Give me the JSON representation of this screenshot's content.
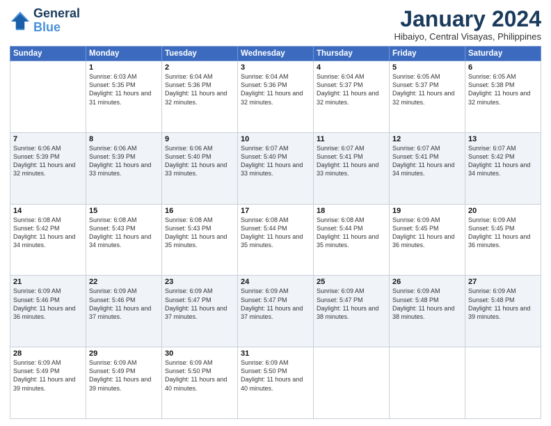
{
  "header": {
    "logo_line1": "General",
    "logo_line2": "Blue",
    "month_title": "January 2024",
    "location": "Hibaiyo, Central Visayas, Philippines"
  },
  "days_of_week": [
    "Sunday",
    "Monday",
    "Tuesday",
    "Wednesday",
    "Thursday",
    "Friday",
    "Saturday"
  ],
  "weeks": [
    [
      {
        "day": "",
        "sunrise": "",
        "sunset": "",
        "daylight": ""
      },
      {
        "day": "1",
        "sunrise": "Sunrise: 6:03 AM",
        "sunset": "Sunset: 5:35 PM",
        "daylight": "Daylight: 11 hours and 31 minutes."
      },
      {
        "day": "2",
        "sunrise": "Sunrise: 6:04 AM",
        "sunset": "Sunset: 5:36 PM",
        "daylight": "Daylight: 11 hours and 32 minutes."
      },
      {
        "day": "3",
        "sunrise": "Sunrise: 6:04 AM",
        "sunset": "Sunset: 5:36 PM",
        "daylight": "Daylight: 11 hours and 32 minutes."
      },
      {
        "day": "4",
        "sunrise": "Sunrise: 6:04 AM",
        "sunset": "Sunset: 5:37 PM",
        "daylight": "Daylight: 11 hours and 32 minutes."
      },
      {
        "day": "5",
        "sunrise": "Sunrise: 6:05 AM",
        "sunset": "Sunset: 5:37 PM",
        "daylight": "Daylight: 11 hours and 32 minutes."
      },
      {
        "day": "6",
        "sunrise": "Sunrise: 6:05 AM",
        "sunset": "Sunset: 5:38 PM",
        "daylight": "Daylight: 11 hours and 32 minutes."
      }
    ],
    [
      {
        "day": "7",
        "sunrise": "Sunrise: 6:06 AM",
        "sunset": "Sunset: 5:39 PM",
        "daylight": "Daylight: 11 hours and 32 minutes."
      },
      {
        "day": "8",
        "sunrise": "Sunrise: 6:06 AM",
        "sunset": "Sunset: 5:39 PM",
        "daylight": "Daylight: 11 hours and 33 minutes."
      },
      {
        "day": "9",
        "sunrise": "Sunrise: 6:06 AM",
        "sunset": "Sunset: 5:40 PM",
        "daylight": "Daylight: 11 hours and 33 minutes."
      },
      {
        "day": "10",
        "sunrise": "Sunrise: 6:07 AM",
        "sunset": "Sunset: 5:40 PM",
        "daylight": "Daylight: 11 hours and 33 minutes."
      },
      {
        "day": "11",
        "sunrise": "Sunrise: 6:07 AM",
        "sunset": "Sunset: 5:41 PM",
        "daylight": "Daylight: 11 hours and 33 minutes."
      },
      {
        "day": "12",
        "sunrise": "Sunrise: 6:07 AM",
        "sunset": "Sunset: 5:41 PM",
        "daylight": "Daylight: 11 hours and 34 minutes."
      },
      {
        "day": "13",
        "sunrise": "Sunrise: 6:07 AM",
        "sunset": "Sunset: 5:42 PM",
        "daylight": "Daylight: 11 hours and 34 minutes."
      }
    ],
    [
      {
        "day": "14",
        "sunrise": "Sunrise: 6:08 AM",
        "sunset": "Sunset: 5:42 PM",
        "daylight": "Daylight: 11 hours and 34 minutes."
      },
      {
        "day": "15",
        "sunrise": "Sunrise: 6:08 AM",
        "sunset": "Sunset: 5:43 PM",
        "daylight": "Daylight: 11 hours and 34 minutes."
      },
      {
        "day": "16",
        "sunrise": "Sunrise: 6:08 AM",
        "sunset": "Sunset: 5:43 PM",
        "daylight": "Daylight: 11 hours and 35 minutes."
      },
      {
        "day": "17",
        "sunrise": "Sunrise: 6:08 AM",
        "sunset": "Sunset: 5:44 PM",
        "daylight": "Daylight: 11 hours and 35 minutes."
      },
      {
        "day": "18",
        "sunrise": "Sunrise: 6:08 AM",
        "sunset": "Sunset: 5:44 PM",
        "daylight": "Daylight: 11 hours and 35 minutes."
      },
      {
        "day": "19",
        "sunrise": "Sunrise: 6:09 AM",
        "sunset": "Sunset: 5:45 PM",
        "daylight": "Daylight: 11 hours and 36 minutes."
      },
      {
        "day": "20",
        "sunrise": "Sunrise: 6:09 AM",
        "sunset": "Sunset: 5:45 PM",
        "daylight": "Daylight: 11 hours and 36 minutes."
      }
    ],
    [
      {
        "day": "21",
        "sunrise": "Sunrise: 6:09 AM",
        "sunset": "Sunset: 5:46 PM",
        "daylight": "Daylight: 11 hours and 36 minutes."
      },
      {
        "day": "22",
        "sunrise": "Sunrise: 6:09 AM",
        "sunset": "Sunset: 5:46 PM",
        "daylight": "Daylight: 11 hours and 37 minutes."
      },
      {
        "day": "23",
        "sunrise": "Sunrise: 6:09 AM",
        "sunset": "Sunset: 5:47 PM",
        "daylight": "Daylight: 11 hours and 37 minutes."
      },
      {
        "day": "24",
        "sunrise": "Sunrise: 6:09 AM",
        "sunset": "Sunset: 5:47 PM",
        "daylight": "Daylight: 11 hours and 37 minutes."
      },
      {
        "day": "25",
        "sunrise": "Sunrise: 6:09 AM",
        "sunset": "Sunset: 5:47 PM",
        "daylight": "Daylight: 11 hours and 38 minutes."
      },
      {
        "day": "26",
        "sunrise": "Sunrise: 6:09 AM",
        "sunset": "Sunset: 5:48 PM",
        "daylight": "Daylight: 11 hours and 38 minutes."
      },
      {
        "day": "27",
        "sunrise": "Sunrise: 6:09 AM",
        "sunset": "Sunset: 5:48 PM",
        "daylight": "Daylight: 11 hours and 39 minutes."
      }
    ],
    [
      {
        "day": "28",
        "sunrise": "Sunrise: 6:09 AM",
        "sunset": "Sunset: 5:49 PM",
        "daylight": "Daylight: 11 hours and 39 minutes."
      },
      {
        "day": "29",
        "sunrise": "Sunrise: 6:09 AM",
        "sunset": "Sunset: 5:49 PM",
        "daylight": "Daylight: 11 hours and 39 minutes."
      },
      {
        "day": "30",
        "sunrise": "Sunrise: 6:09 AM",
        "sunset": "Sunset: 5:50 PM",
        "daylight": "Daylight: 11 hours and 40 minutes."
      },
      {
        "day": "31",
        "sunrise": "Sunrise: 6:09 AM",
        "sunset": "Sunset: 5:50 PM",
        "daylight": "Daylight: 11 hours and 40 minutes."
      },
      {
        "day": "",
        "sunrise": "",
        "sunset": "",
        "daylight": ""
      },
      {
        "day": "",
        "sunrise": "",
        "sunset": "",
        "daylight": ""
      },
      {
        "day": "",
        "sunrise": "",
        "sunset": "",
        "daylight": ""
      }
    ]
  ]
}
